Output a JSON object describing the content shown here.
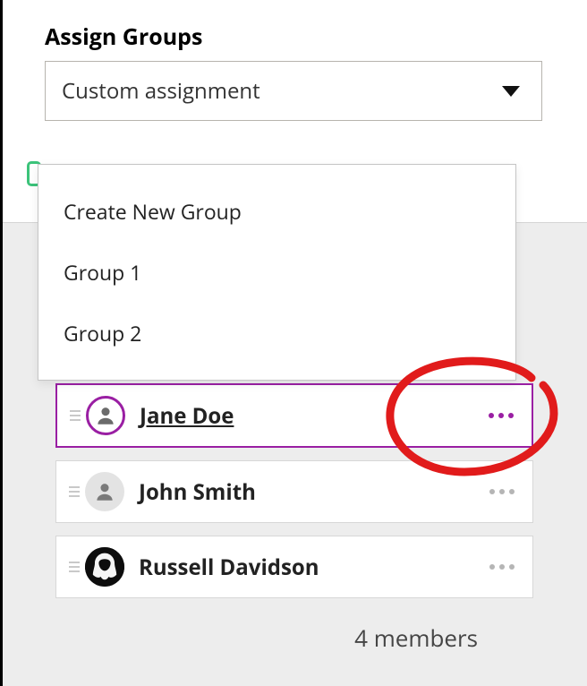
{
  "header": {
    "title": "Assign Groups",
    "selected_option": "Custom assignment"
  },
  "dropdown": {
    "items": [
      {
        "label": "Create New Group"
      },
      {
        "label": "Group 1"
      },
      {
        "label": "Group 2"
      }
    ]
  },
  "members": [
    {
      "name": "Jane Doe",
      "active": true
    },
    {
      "name": "John Smith",
      "active": false
    },
    {
      "name": "Russell Davidson",
      "active": false
    }
  ],
  "footer": {
    "count_text": "4 members"
  },
  "colors": {
    "accent": "#9a1fa3",
    "annotation": "#e11b1b",
    "green": "#3cc37a"
  }
}
